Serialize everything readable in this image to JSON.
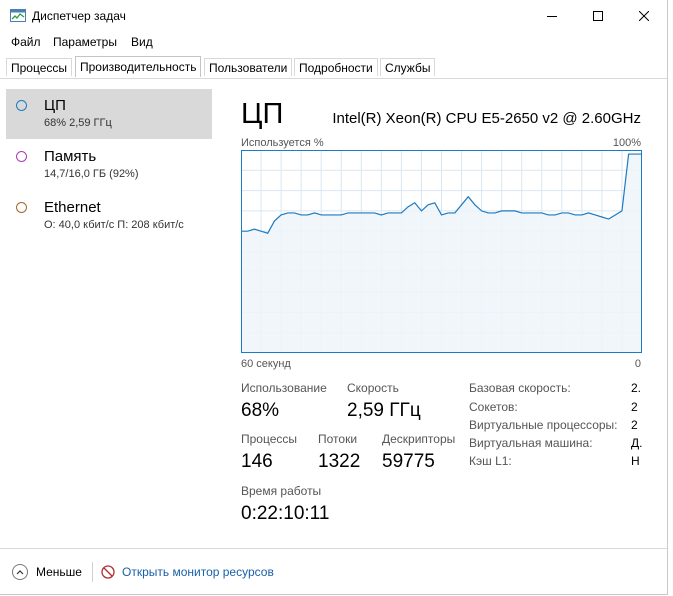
{
  "window": {
    "title": "Диспетчер задач"
  },
  "menu": [
    "Файл",
    "Параметры",
    "Вид"
  ],
  "tabs": [
    "Процессы",
    "Производительность",
    "Пользователи",
    "Подробности",
    "Службы"
  ],
  "sidebar": [
    {
      "title": "ЦП",
      "subtitle": "68% 2,59 ГГц",
      "color": "#1c7bc1"
    },
    {
      "title": "Память",
      "subtitle": "14,7/16,0 ГБ (92%)",
      "color": "#b13ab5"
    },
    {
      "title": "Ethernet",
      "subtitle": "О: 40,0 кбит/с П: 208 кбит/с",
      "color": "#a7662b"
    }
  ],
  "cpu": {
    "heading": "ЦП",
    "model": "Intel(R) Xeon(R) CPU E5-2650 v2 @ 2.60GHz",
    "graph_top_left": "Используется %",
    "graph_top_right": "100%",
    "graph_bottom_left": "60 секунд",
    "graph_bottom_right": "0"
  },
  "chart_data": {
    "type": "area",
    "ylim": [
      0,
      100
    ],
    "xlim": [
      60,
      0
    ],
    "x": [
      60,
      59,
      58,
      57,
      56,
      55,
      54,
      53,
      52,
      51,
      50,
      49,
      48,
      47,
      46,
      45,
      44,
      43,
      42,
      41,
      40,
      39,
      38,
      37,
      36,
      35,
      34,
      33,
      32,
      31,
      30,
      29,
      28,
      27,
      26,
      25,
      24,
      23,
      22,
      21,
      20,
      19,
      18,
      17,
      16,
      15,
      14,
      13,
      12,
      11,
      10,
      9,
      8,
      7,
      6,
      5,
      4,
      3,
      2,
      1,
      0
    ],
    "values": [
      60,
      60,
      61,
      60,
      59,
      65,
      68,
      69,
      69,
      68,
      68,
      69,
      68,
      68,
      68,
      68,
      69,
      69,
      69,
      69,
      69,
      68,
      69,
      69,
      69,
      72,
      74,
      70,
      73,
      74,
      68,
      69,
      69,
      73,
      77,
      73,
      70,
      69,
      69,
      70,
      70,
      70,
      69,
      69,
      69,
      69,
      68,
      68,
      69,
      69,
      68,
      68,
      69,
      68,
      67,
      66,
      68,
      70,
      98,
      98,
      98
    ],
    "grid": true,
    "color": "#1c7bc1",
    "fill": "#eef4fa"
  },
  "stats": [
    {
      "label": "Использование",
      "value": "68%"
    },
    {
      "label": "Скорость",
      "value": "2,59 ГГц"
    },
    {
      "label": "Процессы",
      "value": "146"
    },
    {
      "label": "Потоки",
      "value": "1322"
    },
    {
      "label": "Дескрипторы",
      "value": "59775"
    },
    {
      "label": "Время работы",
      "value": "0:22:10:11"
    }
  ],
  "specs": [
    {
      "label": "Базовая скорость:",
      "value": "2."
    },
    {
      "label": "Сокетов:",
      "value": "2"
    },
    {
      "label": "Виртуальные процессоры:",
      "value": "2"
    },
    {
      "label": "Виртуальная машина:",
      "value": "Д."
    },
    {
      "label": "Кэш L1:",
      "value": "Н"
    }
  ],
  "footer": {
    "less": "Меньше",
    "resource_monitor": "Открыть монитор ресурсов"
  }
}
